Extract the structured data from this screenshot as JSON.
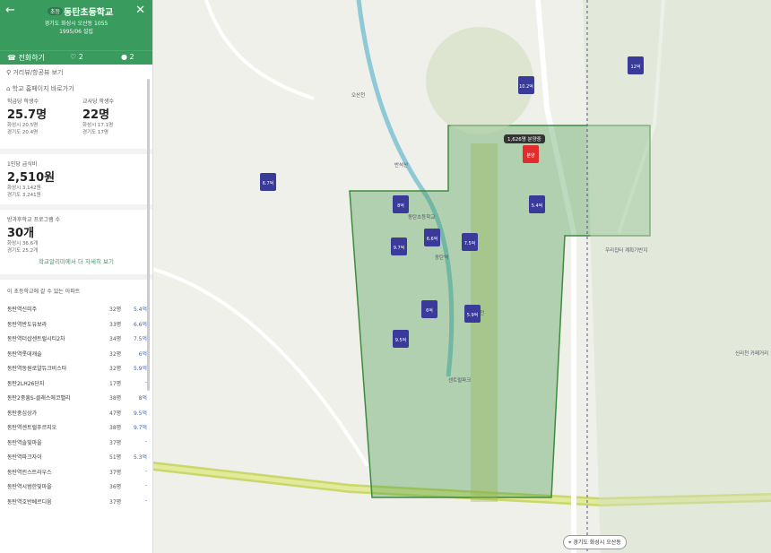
{
  "panel": {
    "back_icon": "back-arrow-icon",
    "close_icon": "close-icon",
    "badge": "초등",
    "school_name": "동탄초등학교",
    "addr1": "경기도 화성시 오산동 1055",
    "addr2": "1995/06 설립",
    "actions": {
      "call": "전화하기",
      "like": "2",
      "comment": "2"
    },
    "link1": "거리뷰/항공뷰 보기",
    "link2": "학교 홈페이지 바로가기",
    "stats": {
      "students_per_teacher_label": "학급당 학생수",
      "students_per_teacher": "25.7명",
      "students_sub1": "화성시 20.5명",
      "students_sub2": "경기도 20.4명",
      "per_teacher_label": "교사당 학생수",
      "per_teacher": "22명",
      "teacher_sub1": "화성시 17.1명",
      "teacher_sub2": "경기도 17명",
      "meal_label": "1인당 급식비",
      "meal": "2,510원",
      "meal_sub1": "화성시 3,142원",
      "meal_sub2": "경기도 3,241원",
      "after_label": "방과후학교 프로그램 수",
      "after": "30개",
      "after_sub1": "화성시 36.6개",
      "after_sub2": "경기도 25.2개"
    },
    "more_link": "학교알리미에서 더 자세히 보기",
    "list_title": "이 초등학교에 갈 수 있는 아파트",
    "apartments": [
      {
        "name": "동탄역신미주",
        "households": "32평",
        "price": "5.4억"
      },
      {
        "name": "동탄역반도유보라",
        "households": "33평",
        "price": "6.6억"
      },
      {
        "name": "동탄역더샵센트럴시티2차",
        "households": "34평",
        "price": "7.5억"
      },
      {
        "name": "동탄역롯데캐슬",
        "households": "32평",
        "price": "6억"
      },
      {
        "name": "동탄역동원로얄듀크비스타",
        "households": "32평",
        "price": "5.9억"
      },
      {
        "name": "동탄2LH26단지",
        "households": "17평",
        "price": "-"
      },
      {
        "name": "동탄2중흥S-클래스에코밸리",
        "households": "38평",
        "price": "8억"
      },
      {
        "name": "동탄중심상가",
        "households": "47평",
        "price": "9.5억"
      },
      {
        "name": "동탄역센트럴푸르지오",
        "households": "38평",
        "price": "9.7억"
      },
      {
        "name": "동탄역솔빛마을",
        "households": "37평",
        "price": "-"
      },
      {
        "name": "동탄역파크자이",
        "households": "51평",
        "price": "5.3억"
      },
      {
        "name": "동탄역린스트라우스",
        "households": "37평",
        "price": "-"
      },
      {
        "name": "동탄역시범한빛마을",
        "households": "36평",
        "price": "-"
      },
      {
        "name": "동탄역호반베르디움",
        "households": "37평",
        "price": "-"
      }
    ]
  },
  "map": {
    "callout": "1,626명 분양중",
    "sale_button": "경기도 화성시 오산동",
    "labels": [
      "동탄초등학교",
      "오산천",
      "센트럴파크",
      "반석산",
      "동탄역",
      "치동천",
      "우리집터 계획기반지",
      "신리천 카페거리"
    ],
    "markers": [
      {
        "price": "5.4억",
        "color": "blue"
      },
      {
        "price": "7.5억",
        "color": "blue"
      },
      {
        "price": "6.6억",
        "color": "blue"
      },
      {
        "price": "9.7억",
        "color": "blue"
      },
      {
        "price": "5.9억",
        "color": "blue"
      },
      {
        "price": "6억",
        "color": "blue"
      },
      {
        "price": "8억",
        "color": "blue"
      },
      {
        "price": "9.5억",
        "color": "blue"
      },
      {
        "price": "10.2억",
        "color": "blue"
      },
      {
        "price": "12억",
        "color": "blue"
      },
      {
        "price": "6.7억",
        "color": "blue"
      },
      {
        "price": "분양",
        "color": "red"
      }
    ]
  }
}
